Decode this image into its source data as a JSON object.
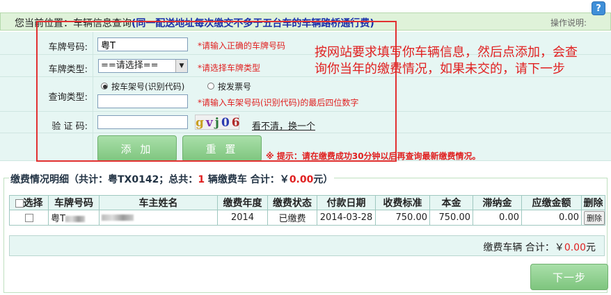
{
  "header": {
    "location_label": "您当前位置：",
    "location_page": "车辆信息查询",
    "notice": "(同一配送地址每次缴交不多于五台车的车辆路桥通行费)",
    "help_label": "操作说明:",
    "help_icon": "question-icon"
  },
  "form": {
    "plate_label": "车牌号码:",
    "plate_value": "粤T",
    "plate_hint": "*请输入正确的车牌号码",
    "type_label": "车牌类型:",
    "type_selected": "==请选择==",
    "type_hint": "*请选择车牌类型",
    "query_label": "查询类型:",
    "query_options": [
      "按车架号(识别代码)",
      "按发票号"
    ],
    "query_hint": "*请输入车架号码(识别代码)的最后四位数字",
    "captcha_label": "验 证 码:",
    "captcha_text": [
      "g",
      "v",
      "j",
      "0",
      "6"
    ],
    "captcha_refresh": "看不清，换一个",
    "add_button": "添 加",
    "reset_button": "重 置",
    "tip": "※ 提示：请在缴费成功30分钟以后再查询最新缴费情况。"
  },
  "annotation": "按网站要求填写你车辆信息，然后点添加，会查询你当年的缴费情况，如果未交的，请下一步",
  "detail": {
    "legend_prefix": "缴费情况明细（共计：粤TX0142；总共：",
    "legend_count": "1",
    "legend_suffix": " 辆缴费车 合计：￥",
    "legend_amount": "0.00",
    "legend_end": "元）",
    "columns": [
      "选择",
      "车牌号码",
      "车主姓名",
      "缴费年度",
      "缴费状态",
      "付款日期",
      "收费标准",
      "本金",
      "滞纳金",
      "应缴金额",
      "删除"
    ],
    "rows": [
      {
        "plate": "粤T",
        "owner": "",
        "year": "2014",
        "status": "已缴费",
        "date": "2014-03-28",
        "standard": "750.00",
        "principal": "750.00",
        "late_fee": "0.00",
        "due": "0.00",
        "delete": "删除"
      }
    ],
    "total_label": "缴费车辆  合计：￥",
    "total_amount": "0.00",
    "total_unit": "元",
    "next_button": "下一步"
  }
}
